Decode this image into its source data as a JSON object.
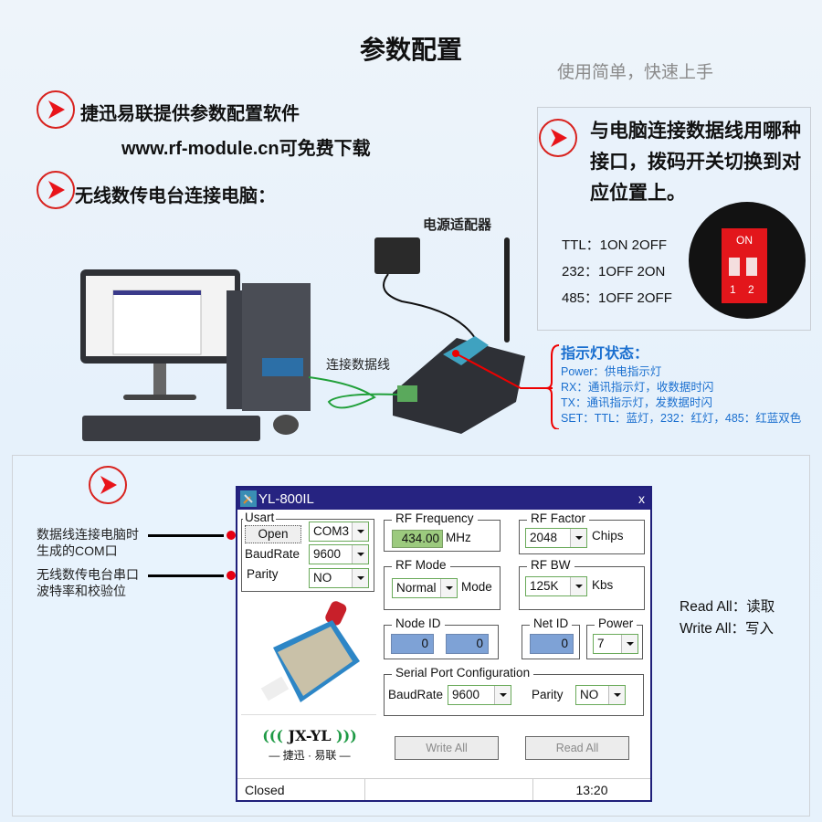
{
  "header": {
    "title": "参数配置",
    "subtitle": "使用简单，快速上手"
  },
  "intro": {
    "line1": "捷迅易联提供参数配置软件",
    "line2": "www.rf-module.cn可免费下载",
    "line3": "无线数传电台连接电脑："
  },
  "diagram": {
    "power_adapter_label": "电源适配器",
    "data_cable_label": "连接数据线"
  },
  "dip_switch": {
    "instruction": [
      "与电脑连接数据线用哪种",
      "接口，拨码开关切换到对",
      "应位置上。"
    ],
    "modes": [
      {
        "name": "TTL：",
        "setting": "1ON  2OFF"
      },
      {
        "name": "232：",
        "setting": "1OFF  2ON"
      },
      {
        "name": "485：",
        "setting": "1OFF  2OFF"
      }
    ],
    "switch_label_on": "ON",
    "switch_numbers": [
      "1",
      "2"
    ],
    "colors": {
      "switch_body": "#e3161b",
      "housing": "#121212"
    }
  },
  "indicator": {
    "title": "指示灯状态：",
    "lines": [
      "Power：供电指示灯",
      "RX：通讯指示灯，收数据时闪",
      "TX：通讯指示灯，发数据时闪",
      "SET：TTL：蓝灯，232：红灯，485：红蓝双色"
    ],
    "color": "#1a6fcf"
  },
  "callouts": {
    "com_port": [
      "数据线连接电脑时",
      "生成的COM口"
    ],
    "baud_parity": [
      "无线数传电台串口",
      "波特率和校验位"
    ]
  },
  "app": {
    "title": "YL-800IL",
    "close_label": "x",
    "usart": {
      "legend": "Usart",
      "open_label": "Open",
      "com_port": "COM3",
      "baudrate_label": "BaudRate",
      "baudrate": "9600",
      "parity_label": "Parity",
      "parity": "NO"
    },
    "rf_frequency": {
      "legend": "RF Frequency",
      "value": "434.00",
      "unit": "MHz"
    },
    "rf_factor": {
      "legend": "RF Factor",
      "value": "2048",
      "unit": "Chips"
    },
    "rf_mode": {
      "legend": "RF Mode",
      "value": "Normal",
      "unit": "Mode"
    },
    "rf_bw": {
      "legend": "RF BW",
      "value": "125K",
      "unit": "Kbs"
    },
    "node_id": {
      "legend": "Node ID",
      "value1": "0",
      "value2": "0"
    },
    "net_id": {
      "legend": "Net ID",
      "value": "0"
    },
    "power": {
      "legend": "Power",
      "value": "7"
    },
    "serial_port": {
      "legend": "Serial Port Configuration",
      "baudrate_label": "BaudRate",
      "baudrate": "9600",
      "parity_label": "Parity",
      "parity": "NO"
    },
    "logo": {
      "brand": "JX-YL",
      "cn": "捷迅 · 易联"
    },
    "write_all_label": "Write All",
    "read_all_label": "Read All",
    "status": {
      "connection": "Closed",
      "middle": "",
      "time": "13:20"
    }
  },
  "notes": {
    "read_all": "Read All：读取",
    "write_all": "Write All：写入"
  }
}
